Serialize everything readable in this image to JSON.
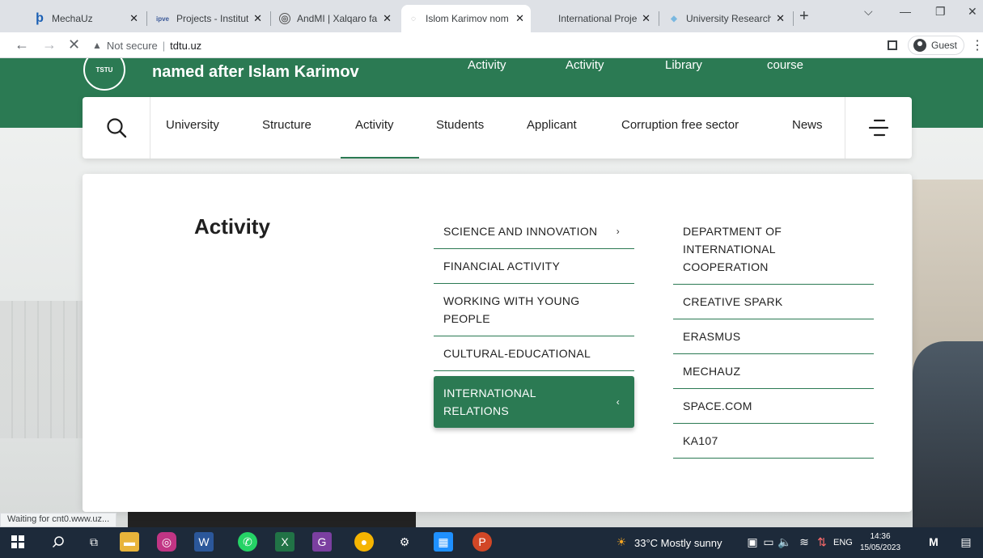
{
  "browser": {
    "tabs": [
      {
        "title": "MechaUz",
        "fav_color": "#1a5fb4",
        "fav_char": "þ"
      },
      {
        "title": "Projects - Instituto",
        "fav_color": "#3b5998",
        "fav_char": "ipve"
      },
      {
        "title": "AndMI | Xalqaro fa",
        "fav_color": "#555555",
        "fav_char": "◎"
      },
      {
        "title": "Islom Karimov nom",
        "fav_color": "#cccccc",
        "fav_char": "◌"
      },
      {
        "title": "International Proje",
        "fav_color": "#ffffff",
        "fav_char": ""
      },
      {
        "title": "University Research",
        "fav_color": "#7ab8e0",
        "fav_char": "◆"
      }
    ],
    "new_tab": "+",
    "address": {
      "warning": "Not secure",
      "url": "tdtu.uz"
    },
    "guest_label": "Guest"
  },
  "site": {
    "university_name": "named after Islam Karimov",
    "logo_text": "TSTU",
    "top_links": [
      "Activity",
      "Activity",
      "Library",
      "course"
    ],
    "nav_items": [
      "University",
      "Structure",
      "Activity",
      "Students",
      "Applicant",
      "Corruption free sector",
      "News"
    ],
    "active_nav": "Activity"
  },
  "mega_menu": {
    "title": "Activity",
    "column1": [
      {
        "label": "SCIENCE AND INNOVATION",
        "chevron": "›",
        "active": false
      },
      {
        "label": "FINANCIAL ACTIVITY",
        "chevron": "",
        "active": false
      },
      {
        "label": "WORKING WITH YOUNG PEOPLE",
        "chevron": "",
        "active": false
      },
      {
        "label": "CULTURAL-EDUCATIONAL",
        "chevron": "",
        "active": false
      },
      {
        "label": "INTERNATIONAL RELATIONS",
        "chevron": "‹",
        "active": true
      }
    ],
    "column2": [
      "DEPARTMENT OF INTERNATIONAL COOPERATION",
      "CREATIVE SPARK",
      "ERASMUS",
      "MECHAUZ",
      "SPACE.COM",
      "KA107"
    ]
  },
  "status_bar": "Waiting for cnt0.www.uz...",
  "taskbar": {
    "weather": "33°C  Mostly sunny",
    "language": "ENG",
    "time": "14:36",
    "date": "15/05/2023"
  },
  "colors": {
    "brand_green": "#2b7a53",
    "taskbar": "#1d2a3a"
  }
}
